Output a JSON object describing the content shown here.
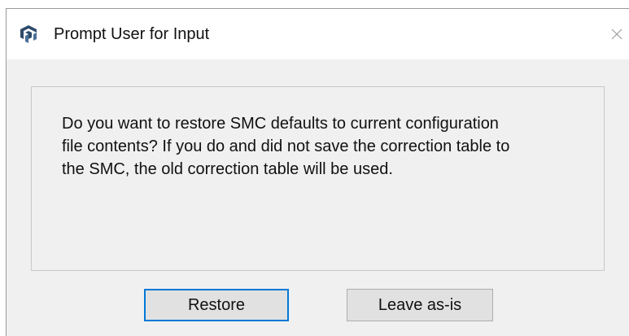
{
  "window": {
    "title": "Prompt User for Input",
    "icon": "app-cube-icon",
    "close_glyph": "×"
  },
  "message": {
    "text": "Do you want to restore SMC defaults to current configuration\nfile contents?  If you do and did not save the correction table to\nthe SMC, the old correction table will be used."
  },
  "buttons": {
    "restore_label": "Restore",
    "leave_label": "Leave as-is"
  },
  "colors": {
    "focus_border": "#0078d7",
    "dialog_background": "#f0f0f0",
    "titlebar_background": "#ffffff"
  }
}
